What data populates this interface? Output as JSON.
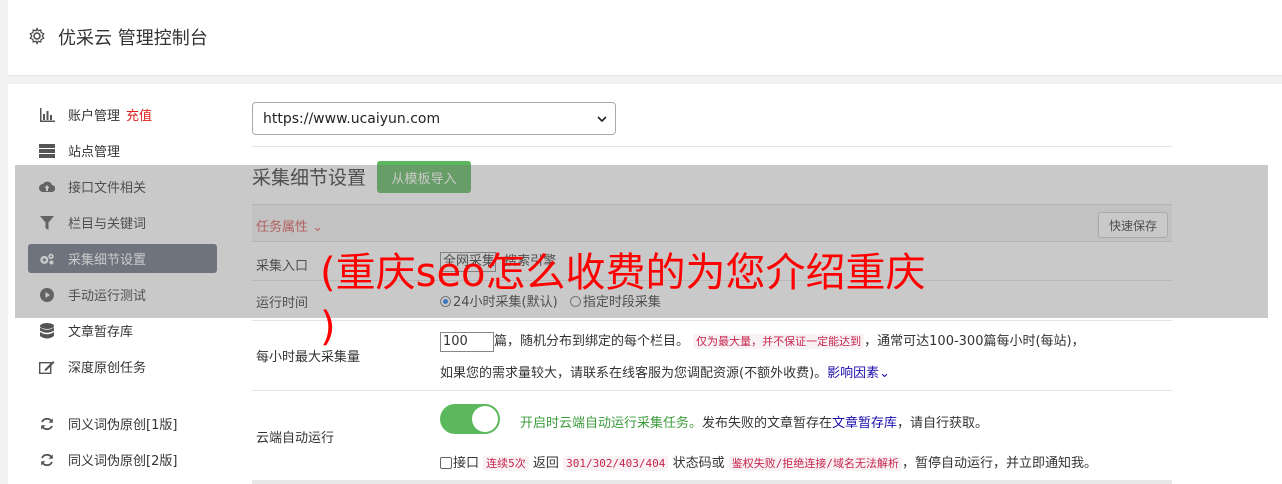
{
  "header": {
    "title": "优采云 管理控制台"
  },
  "sidebar": {
    "items": [
      {
        "label": "账户管理",
        "extra": "充值",
        "icon": "bar-chart-icon"
      },
      {
        "label": "站点管理",
        "icon": "server-icon"
      },
      {
        "label": "接口文件相关",
        "icon": "cloud-upload-icon"
      },
      {
        "label": "栏目与关键词",
        "icon": "filter-icon"
      },
      {
        "label": "采集细节设置",
        "icon": "cogs-icon",
        "active": true
      },
      {
        "label": "手动运行测试",
        "icon": "play-circle-icon"
      },
      {
        "label": "文章暂存库",
        "icon": "database-icon"
      },
      {
        "label": "深度原创任务",
        "icon": "edit-icon"
      },
      {
        "label": "同义词伪原创[1版]",
        "icon": "refresh-icon"
      },
      {
        "label": "同义词伪原创[2版]",
        "icon": "refresh-icon"
      }
    ]
  },
  "site_select": {
    "value": "https://www.ucaiyun.com"
  },
  "section": {
    "title": "采集细节设置",
    "template_button": "从模板导入"
  },
  "task_props": {
    "label": "任务属性",
    "save_button": "快速保存"
  },
  "rows": {
    "entry": {
      "label": "采集入口",
      "value": "全网采集",
      "hint": "搜索引擎"
    },
    "runtime": {
      "label": "运行时间",
      "opt1": "24小时采集(默认)",
      "opt2": "指定时段采集"
    },
    "max": {
      "label": "每小时最大采集量",
      "value": "100",
      "text1": "篇，随机分布到绑定的每个栏目。",
      "code1": "仅为最大量，并不保证一定能达到",
      "text2": "，通常可达100-300篇每小时(每站)，",
      "text3": "如果您的需求量较大，请联系在线客服为您调配资源(不额外收费)。",
      "link": "影响因素"
    },
    "cloud": {
      "label": "云端自动运行",
      "green": "开启时云端自动运行采集任务。",
      "text1": "发布失败的文章暂存在",
      "link": "文章暂存库",
      "text2": "，请自行获取。",
      "chk_label": "接口",
      "code1": "连续5次",
      "t1": "返回",
      "code2": "301/302/403/404",
      "t2": "状态码或",
      "code3": "鉴权失败/拒绝连接/域名无法解析",
      "t3": "，暂停自动运行，并立即通知我。"
    }
  },
  "watermark": {
    "line1": "(重庆seo怎么收费的为您介绍重庆",
    "line2": ")"
  }
}
